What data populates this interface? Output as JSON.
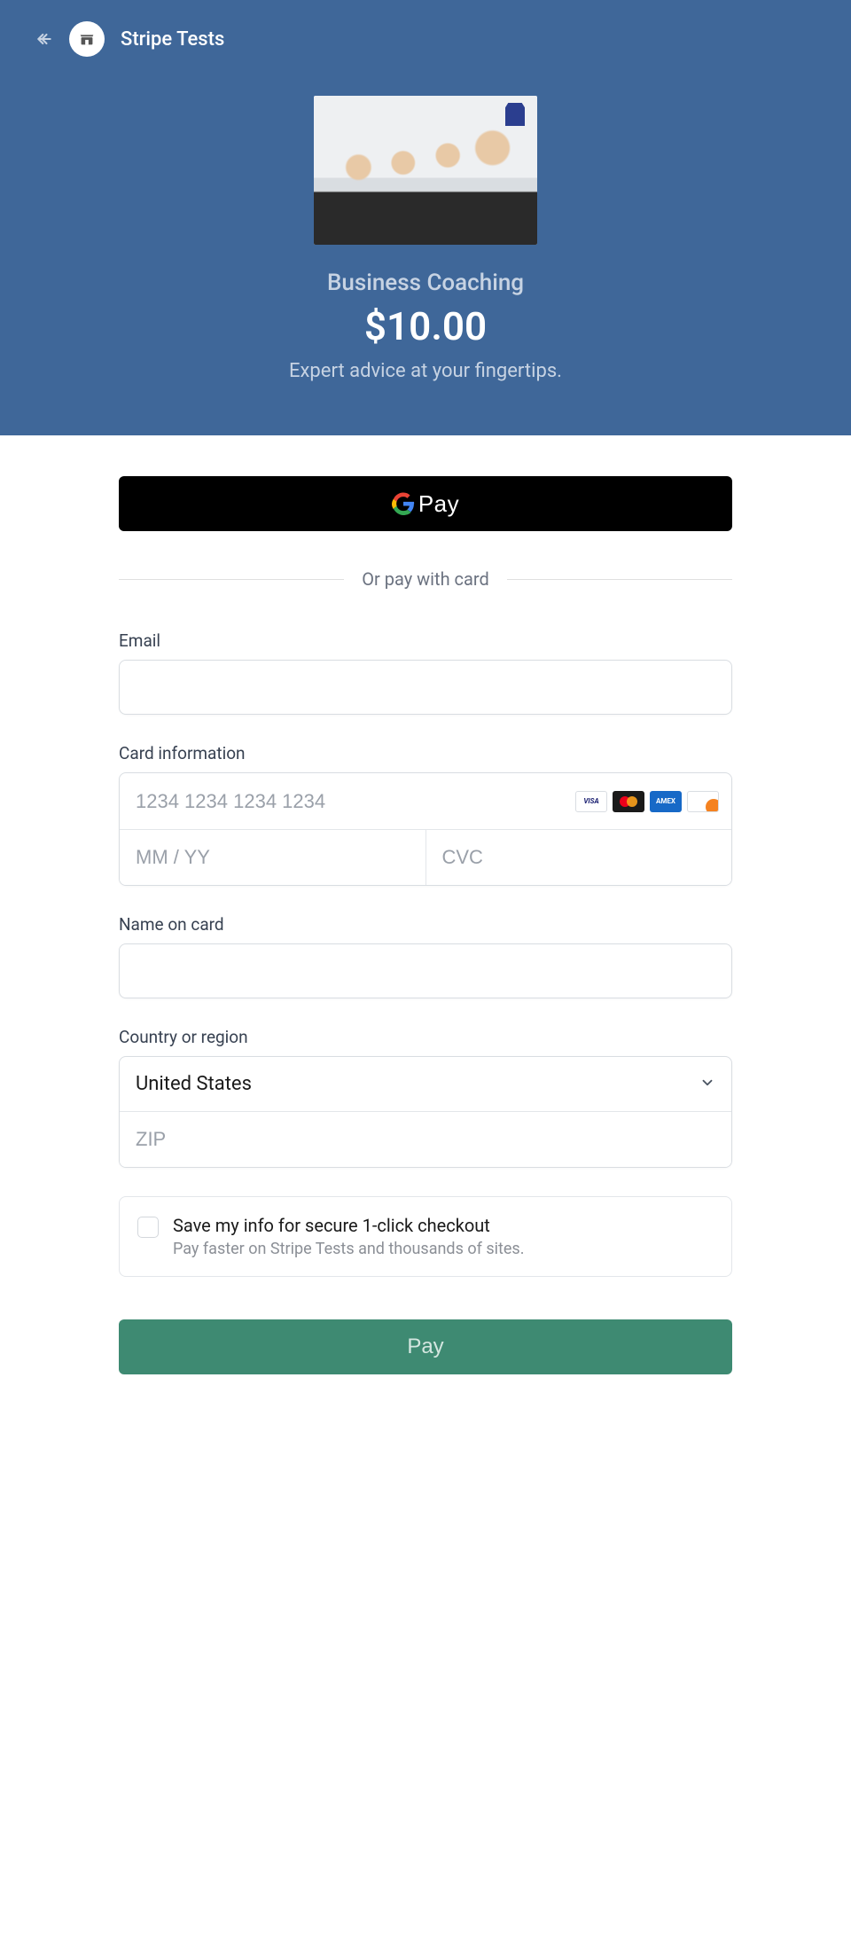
{
  "header": {
    "merchant_name": "Stripe Tests"
  },
  "product": {
    "title": "Business Coaching",
    "price": "$10.00",
    "description": "Expert advice at your fingertips."
  },
  "gpay": {
    "label": "Pay"
  },
  "divider_text": "Or pay with card",
  "fields": {
    "email": {
      "label": "Email",
      "value": ""
    },
    "card": {
      "label": "Card information",
      "number_placeholder": "1234 1234 1234 1234",
      "exp_placeholder": "MM / YY",
      "cvc_placeholder": "CVC"
    },
    "name": {
      "label": "Name on card",
      "value": ""
    },
    "country": {
      "label": "Country or region",
      "selected": "United States",
      "zip_placeholder": "ZIP"
    }
  },
  "save_info": {
    "title": "Save my info for secure 1-click checkout",
    "subtitle": "Pay faster on Stripe Tests and thousands of sites."
  },
  "pay_button": "Pay"
}
